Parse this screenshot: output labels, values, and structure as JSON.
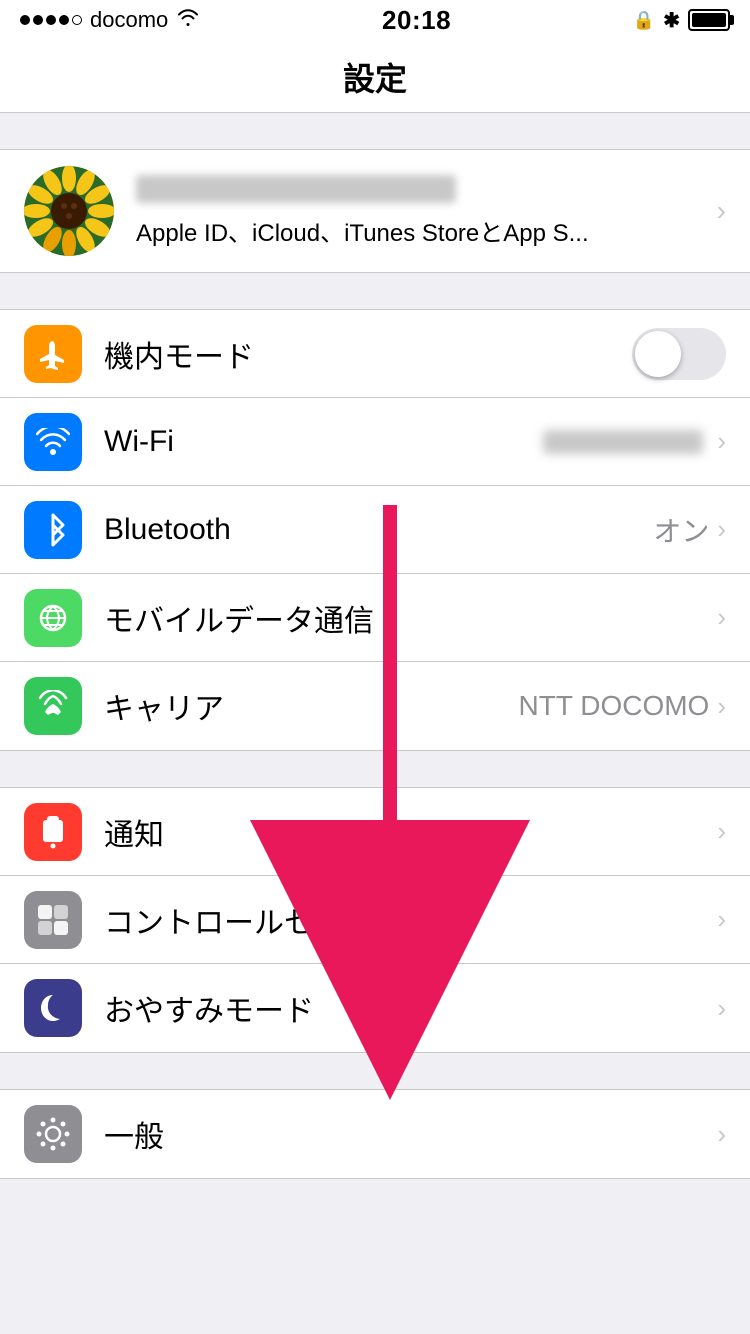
{
  "statusBar": {
    "carrier": "docomo",
    "time": "20:18",
    "lock_icon": "🔒",
    "bt_icon": "✱"
  },
  "pageTitle": "設定",
  "profile": {
    "subtitle": "Apple ID、iCloud、iTunes StoreとApp S...",
    "chevron": "›"
  },
  "sections": [
    {
      "id": "network",
      "rows": [
        {
          "id": "airplane",
          "icon_class": "icon-orange",
          "icon": "✈",
          "label": "機内モード",
          "type": "toggle",
          "value": "",
          "chevron": ""
        },
        {
          "id": "wifi",
          "icon_class": "icon-blue",
          "icon": "wifi",
          "label": "Wi-Fi",
          "type": "blurred-chevron",
          "value": "",
          "chevron": "›"
        },
        {
          "id": "bluetooth",
          "icon_class": "icon-blue-bt",
          "icon": "bt",
          "label": "Bluetooth",
          "type": "value-chevron",
          "value": "オン",
          "chevron": "›"
        },
        {
          "id": "mobile-data",
          "icon_class": "icon-green",
          "icon": "mobile",
          "label": "モバイルデータ通信",
          "type": "chevron-only",
          "value": "",
          "chevron": "›"
        },
        {
          "id": "carrier",
          "icon_class": "icon-green2",
          "icon": "phone",
          "label": "キャリア",
          "type": "value-chevron",
          "value": "NTT DOCOMO",
          "chevron": "›"
        }
      ]
    },
    {
      "id": "system",
      "rows": [
        {
          "id": "notifications",
          "icon_class": "icon-red",
          "icon": "notif",
          "label": "通知",
          "type": "chevron-only",
          "value": "",
          "chevron": "›"
        },
        {
          "id": "control-center",
          "icon_class": "icon-gray",
          "icon": "control",
          "label": "コントロールセンター",
          "type": "chevron-only",
          "value": "",
          "chevron": "›"
        },
        {
          "id": "do-not-disturb",
          "icon_class": "icon-dark-blue",
          "icon": "moon",
          "label": "おやすみモード",
          "type": "chevron-only",
          "value": "",
          "chevron": "›"
        }
      ]
    },
    {
      "id": "more",
      "rows": [
        {
          "id": "general",
          "icon_class": "icon-gray2",
          "icon": "gear",
          "label": "一般",
          "type": "chevron-only",
          "value": "",
          "chevron": "›"
        }
      ]
    }
  ]
}
